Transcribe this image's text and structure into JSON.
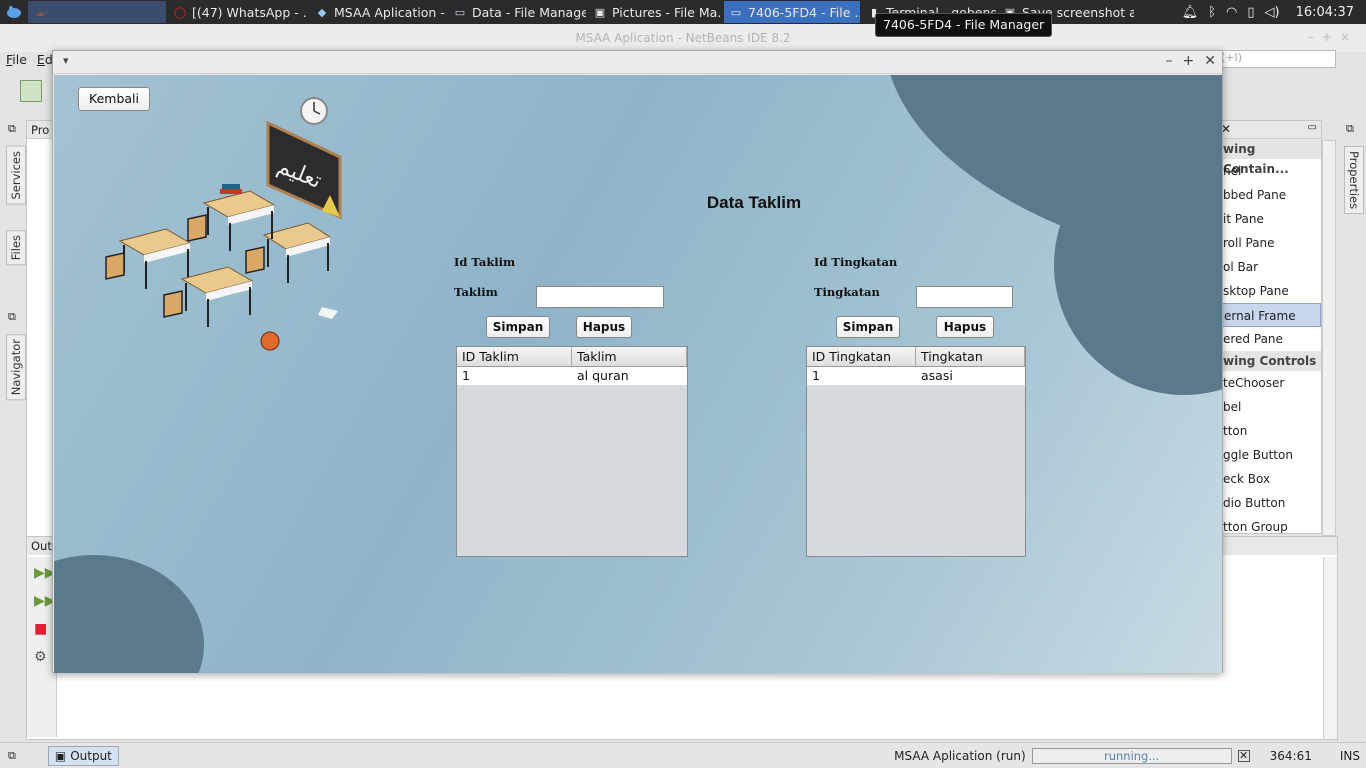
{
  "taskbar": {
    "tasks": [
      {
        "label": "",
        "icon": "java-icon",
        "active": false
      },
      {
        "label": "[(47) WhatsApp - ...",
        "icon": "opera-icon"
      },
      {
        "label": "MSAA Aplication -...",
        "icon": "netbeans-icon"
      },
      {
        "label": "Data - File Manager",
        "icon": "folder-icon"
      },
      {
        "label": "Pictures - File Ma...",
        "icon": "camera-icon"
      },
      {
        "label": "7406-5FD4 - File ...",
        "icon": "folder-icon",
        "active": true
      },
      {
        "label": "Terminal - gobeng...",
        "icon": "terminal-icon"
      },
      {
        "label": "Save screenshot a...",
        "icon": "camera-icon"
      }
    ],
    "clock": "16:04:37",
    "tooltip": "7406-5FD4 - File Manager"
  },
  "ide": {
    "title": "MSAA Aplication - NetBeans IDE 8.2",
    "menu": [
      "File",
      "Ed"
    ],
    "left_tabs": [
      "Services",
      "Files",
      "Navigator"
    ],
    "right_tab": "Properties",
    "projects_tab": "Pro",
    "output_tab": "Out",
    "search_placeholder": "(+I)",
    "palette": {
      "categories": [
        "wing Contain...",
        "wing Controls"
      ],
      "containers": [
        "nel",
        "bbed Pane",
        "it Pane",
        "roll Pane",
        "ol Bar",
        "sktop Pane",
        "ernal Frame",
        "ered Pane"
      ],
      "controls": [
        "teChooser",
        "bel",
        "tton",
        "ggle Button",
        "eck Box",
        "dio Button",
        "tton Group"
      ],
      "selected": "ernal Frame"
    },
    "status": {
      "output_label": "Output",
      "run_label": "MSAA Aplication (run)",
      "progress_text": "running...",
      "position": "364:61",
      "mode": "INS"
    }
  },
  "app": {
    "back_button": "Kembali",
    "title": "Data Taklim",
    "chalkboard_text": "تعليم",
    "left": {
      "id_label": "Id Taklim",
      "name_label": "Taklim",
      "name_value": "",
      "save_button": "Simpan",
      "delete_button": "Hapus",
      "columns": [
        "ID Taklim",
        "Taklim"
      ],
      "rows": [
        [
          "1",
          "al quran"
        ]
      ]
    },
    "right": {
      "id_label": "Id Tingkatan",
      "name_label": "Tingkatan",
      "name_value": "",
      "save_button": "Simpan",
      "delete_button": "Hapus",
      "columns": [
        "ID Tingkatan",
        "Tingkatan"
      ],
      "rows": [
        [
          "1",
          "asasi"
        ]
      ]
    }
  },
  "colors": {
    "taskbar_bg": "#2b2b2b",
    "taskbar_active": "#3d6fbf",
    "content_bg": "#8fb4c9",
    "blob": "#5a7a8b"
  }
}
